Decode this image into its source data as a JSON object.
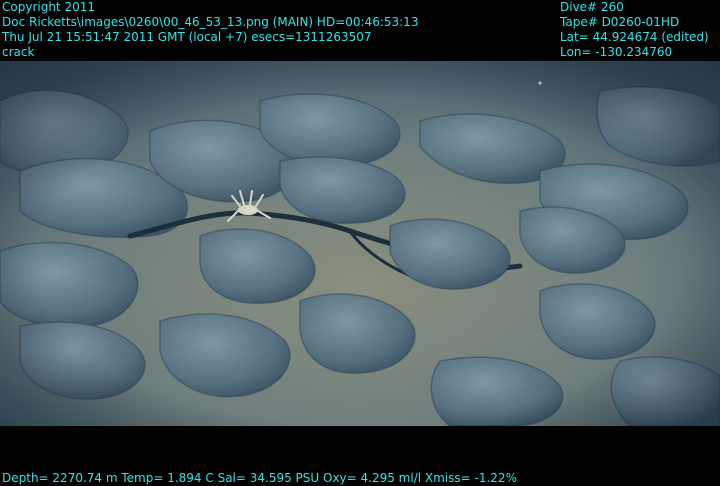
{
  "header": {
    "left": {
      "copyright": "Copyright 2011",
      "source": "Doc Ricketts\\images\\0260\\00_46_53_13.png (MAIN)  HD=00:46:53:13",
      "datetime": "Thu Jul 21 15:51:47 2011 GMT (local +7)  esecs=1311263507",
      "label": "crack"
    },
    "right": {
      "dive": "Dive# 260",
      "tape": "Tape# D0260-01HD",
      "lat": "Lat= 44.924674 (edited)",
      "lon": "Lon= -130.234760"
    }
  },
  "footer": {
    "telemetry": "Depth= 2270.74 m  Temp= 1.894 C  Sal= 34.595 PSU  Oxy= 4.295 ml/l  Xmiss= -1.22%"
  },
  "colors": {
    "overlay_text": "#2fe6ea",
    "band": "#000000",
    "seafloor_sediment": "#7f8a7f",
    "basalt": "#5a7786"
  }
}
